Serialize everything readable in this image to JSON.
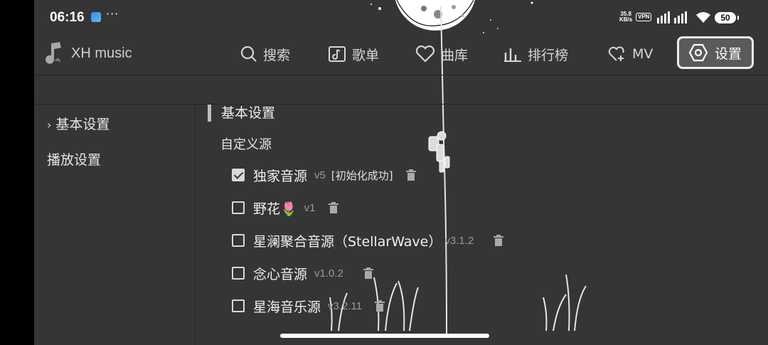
{
  "status_bar": {
    "time": "06:16",
    "dots": "···",
    "net_speed_value": "35.8",
    "net_speed_unit": "KB/s",
    "vpn": "VPN",
    "battery": "50"
  },
  "app": {
    "name": "XH music"
  },
  "nav": {
    "search": "搜索",
    "playlist": "歌单",
    "library": "曲库",
    "rank": "排行榜",
    "mv": "MV",
    "settings": "设置"
  },
  "sidebar": {
    "items": [
      {
        "label": "基本设置",
        "active": true
      },
      {
        "label": "播放设置",
        "active": false
      }
    ]
  },
  "content": {
    "section_title": "基本设置",
    "subsection_title": "自定义源",
    "sources": [
      {
        "name": "独家音源",
        "version": "v5",
        "status": "[初始化成功]",
        "checked": true
      },
      {
        "name": "野花🌷",
        "version": "v1",
        "status": "",
        "checked": false
      },
      {
        "name": "星澜聚合音源（StellarWave）",
        "version": "v3.1.2",
        "status": "",
        "checked": false
      },
      {
        "name": "念心音源",
        "version": "v1.0.2",
        "status": "",
        "checked": false
      },
      {
        "name": "星海音乐源",
        "version": "v3.2.11",
        "status": "",
        "checked": false
      }
    ]
  },
  "colors": {
    "background": "#353535",
    "divider": "#262626",
    "text": "#e8e8e8",
    "muted": "#9a9a9a"
  }
}
